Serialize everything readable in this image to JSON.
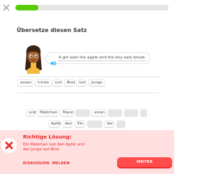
{
  "progress": {
    "percent": 15
  },
  "prompt": {
    "title": "Übersetze diesen Satz"
  },
  "bubble": {
    "sentence": "A girl eats the apple and the boy eats bread."
  },
  "answer_words": [
    "essen",
    "trinke",
    "isst",
    "Brot",
    "isst",
    "Junge"
  ],
  "word_bank": {
    "row1": [
      "und",
      "Mädchen",
      "Mann",
      "",
      "einen",
      "",
      "",
      ""
    ],
    "row2": [
      "Apfel",
      "den",
      "Ein",
      "",
      "der",
      ""
    ]
  },
  "feedback": {
    "title": "Richtige Lösung:",
    "answer": "Ein Mädchen isst den Apfel und der Junge isst Brot.",
    "discuss_label": "DISKUSSION",
    "report_label": "MELDEN",
    "continue_label": "WEITER"
  },
  "colors": {
    "progress": "#58cc02",
    "error_bg": "#ffdfe0",
    "error_text": "#ea2b2b",
    "error_button": "#ff4b4b",
    "speaker": "#1cb0f6"
  }
}
